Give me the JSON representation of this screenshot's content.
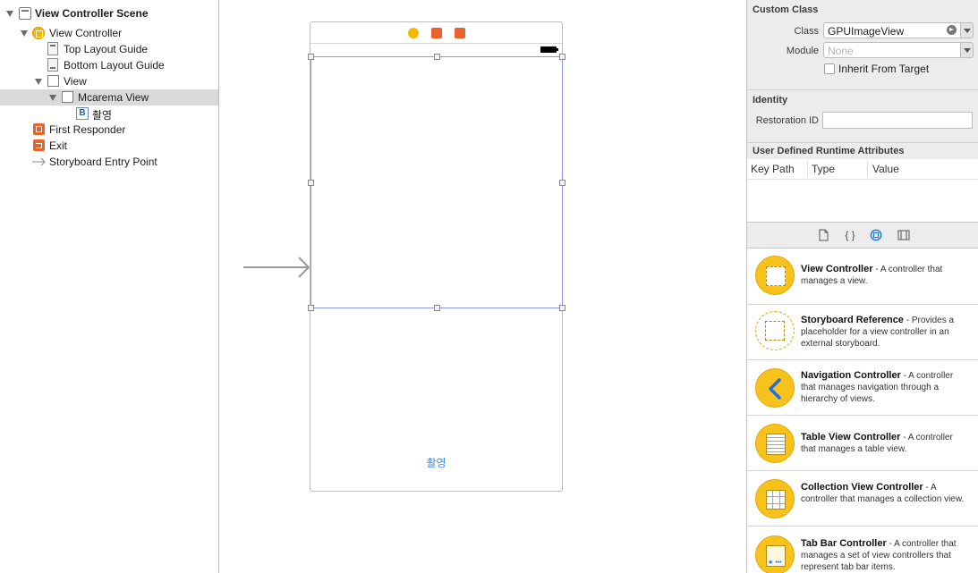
{
  "outline": {
    "items": [
      {
        "label": "View Controller Scene",
        "icon": "storyboard-scene-icon"
      },
      {
        "label": "View Controller",
        "icon": "view-controller-icon"
      },
      {
        "label": "Top Layout Guide",
        "icon": "layout-guide-icon"
      },
      {
        "label": "Bottom Layout Guide",
        "icon": "layout-guide-icon"
      },
      {
        "label": "View",
        "icon": "view-icon"
      },
      {
        "label": "Mcarema View",
        "icon": "view-icon"
      },
      {
        "label": "촬영",
        "icon": "button-icon",
        "icon_glyph": "B"
      },
      {
        "label": "First Responder",
        "icon": "first-responder-icon"
      },
      {
        "label": "Exit",
        "icon": "exit-icon"
      },
      {
        "label": "Storyboard Entry Point",
        "icon": "entry-point-arrow-icon"
      }
    ]
  },
  "canvas": {
    "button_title": "촬영",
    "colors": {
      "selection": "#8e94e8",
      "button_text": "#3a8ee6"
    }
  },
  "inspector": {
    "custom_class": {
      "title": "Custom Class",
      "class_label": "Class",
      "class_value": "GPUImageView",
      "module_label": "Module",
      "module_placeholder": "None",
      "inherit_label": "Inherit From Target"
    },
    "identity": {
      "title": "Identity",
      "restoration_label": "Restoration ID",
      "restoration_value": ""
    },
    "runtime_attributes": {
      "title": "User Defined Runtime Attributes",
      "columns": [
        "Key Path",
        "Type",
        "Value"
      ]
    },
    "library_tabs": [
      "file-template-icon",
      "code-snippet-icon",
      "object-library-icon",
      "media-library-icon"
    ],
    "library_items": [
      {
        "title": "View Controller",
        "desc": " - A controller that manages a view.",
        "icon": "view-controller-icon"
      },
      {
        "title": "Storyboard Reference",
        "desc": " - Provides a placeholder for a view controller in an external storyboard.",
        "icon": "storyboard-reference-icon"
      },
      {
        "title": "Navigation Controller",
        "desc": " - A controller that manages navigation through a hierarchy of views.",
        "icon": "navigation-controller-icon"
      },
      {
        "title": "Table View Controller",
        "desc": " - A controller that manages a table view.",
        "icon": "table-view-controller-icon"
      },
      {
        "title": "Collection View Controller",
        "desc": " - A controller that manages a collection view.",
        "icon": "collection-view-controller-icon"
      },
      {
        "title": "Tab Bar Controller",
        "desc": " - A controller that manages a set of view controllers that represent tab bar items.",
        "icon": "tab-bar-controller-icon"
      }
    ],
    "colors": {
      "accent": "#f7c21b",
      "tab_selected": "#1f7ae0"
    }
  }
}
